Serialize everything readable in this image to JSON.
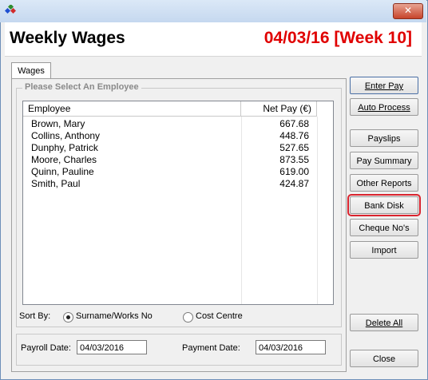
{
  "window": {
    "close_glyph": "✕"
  },
  "header": {
    "title": "Weekly Wages",
    "week": "04/03/16 [Week 10]"
  },
  "tabs": [
    {
      "label": "Wages"
    }
  ],
  "employee_group": {
    "label": "Please Select An Employee",
    "columns": {
      "employee": "Employee",
      "net_pay": "Net Pay (€)"
    },
    "rows": [
      {
        "employee": "Brown, Mary",
        "net_pay": "667.68"
      },
      {
        "employee": "Collins, Anthony",
        "net_pay": "448.76"
      },
      {
        "employee": "Dunphy, Patrick",
        "net_pay": "527.65"
      },
      {
        "employee": "Moore, Charles",
        "net_pay": "873.55"
      },
      {
        "employee": "Quinn, Pauline",
        "net_pay": "619.00"
      },
      {
        "employee": "Smith, Paul",
        "net_pay": "424.87"
      }
    ]
  },
  "sort": {
    "label": "Sort By:",
    "options": [
      {
        "label": "Surname/Works No",
        "selected": true
      },
      {
        "label": "Cost Centre",
        "selected": false
      }
    ]
  },
  "dates": {
    "payroll_label": "Payroll Date:",
    "payroll_value": "04/03/2016",
    "payment_label": "Payment Date:",
    "payment_value": "04/03/2016"
  },
  "buttons": {
    "enter_pay": "Enter Pay",
    "auto_process": "Auto Process",
    "payslips": "Payslips",
    "pay_summary": "Pay Summary",
    "other_reports": "Other Reports",
    "bank_disk": "Bank Disk",
    "cheque_nos": "Cheque No's",
    "import": "Import",
    "delete_all": "Delete All",
    "close": "Close"
  },
  "colors": {
    "week_text": "#e00000",
    "highlight_border": "#d9232e"
  }
}
